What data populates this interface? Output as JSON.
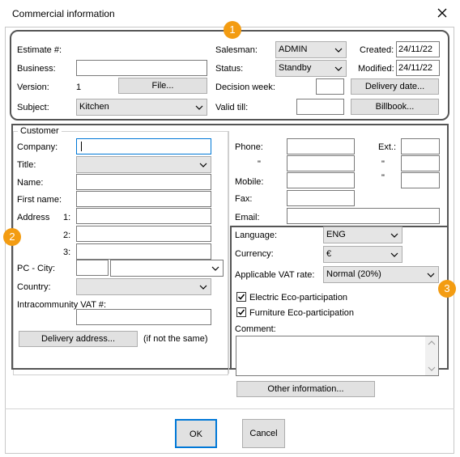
{
  "window": {
    "title": "Commercial information"
  },
  "header": {
    "estimate_label": "Estimate #:",
    "business_label": "Business:",
    "business_value": "",
    "version_label": "Version:",
    "version_value": "1",
    "file_button": "File...",
    "subject_label": "Subject:",
    "subject_value": "Kitchen",
    "salesman_label": "Salesman:",
    "salesman_value": "ADMIN",
    "status_label": "Status:",
    "status_value": "Standby",
    "decision_week_label": "Decision week:",
    "decision_week_value": "",
    "valid_till_label": "Valid till:",
    "valid_till_value": "",
    "created_label": "Created:",
    "created_value": "24/11/22",
    "modified_label": "Modified:",
    "modified_value": "24/11/22",
    "delivery_date_button": "Delivery date...",
    "billbook_button": "Billbook..."
  },
  "customer": {
    "group_label": "Customer",
    "company_label": "Company:",
    "title_label": "Title:",
    "name_label": "Name:",
    "first_name_label": "First name:",
    "address_label": "Address",
    "address_line1": "1:",
    "address_line2": "2:",
    "address_line3": "3:",
    "pc_city_label": "PC - City:",
    "country_label": "Country:",
    "vat_label": "Intracommunity VAT #:",
    "delivery_address_button": "Delivery address...",
    "delivery_note": "(if not the same)"
  },
  "contact": {
    "phone_label": "Phone:",
    "ext_label": "Ext.:",
    "ditto": "\"",
    "mobile_label": "Mobile:",
    "fax_label": "Fax:",
    "email_label": "Email:"
  },
  "settings": {
    "language_label": "Language:",
    "language_value": "ENG",
    "currency_label": "Currency:",
    "currency_value": "€",
    "vat_rate_label": "Applicable VAT rate:",
    "vat_rate_value": "Normal (20%)",
    "electric_eco": "Electric Eco-participation",
    "furniture_eco": "Furniture Eco-participation",
    "comment_label": "Comment:",
    "other_info_button": "Other information..."
  },
  "footer": {
    "ok_button": "OK",
    "cancel_button": "Cancel"
  },
  "badges": {
    "b1": "1",
    "b2": "2",
    "b3": "3"
  },
  "colors": {
    "badge": "#f39c12",
    "frame": "#555555",
    "focus": "#0078d7"
  }
}
